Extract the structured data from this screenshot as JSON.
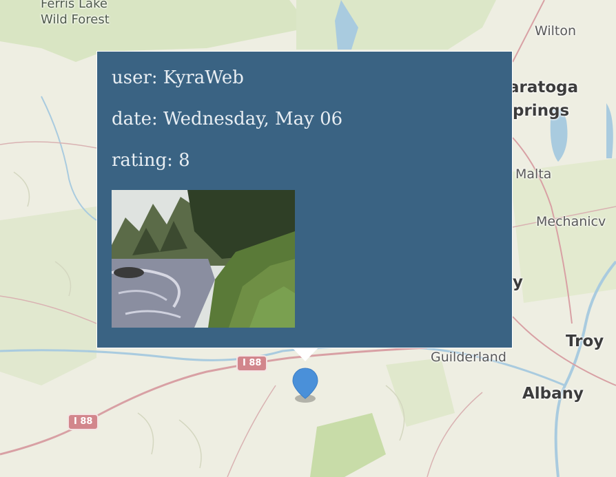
{
  "map": {
    "places": {
      "ferris_lake": "Ferris Lake",
      "wild_forest": "Wild Forest",
      "wilton": "Wilton",
      "saratoga_partial": "aratoga",
      "springs_partial": "prings",
      "malta": "Malta",
      "mechanicville_partial": "Mechanicv",
      "y_partial": "y",
      "guilderland": "Guilderland",
      "troy": "Troy",
      "albany": "Albany"
    },
    "shields": {
      "i88_east": "I 88",
      "i88_west": "I 88"
    },
    "colors": {
      "land": "#eeeee2",
      "forest": "#dbe6c6",
      "protected_area": "#cfe1b4",
      "water": "#a9cbdf",
      "highway": "#d2868c"
    }
  },
  "popup": {
    "user": "user: KyraWeb",
    "date": "date: Wednesday, May 06",
    "rating": "rating: 8",
    "background": "#3a6383"
  },
  "marker": {
    "color": "#4a90d9",
    "icon": "map-pin-icon"
  }
}
